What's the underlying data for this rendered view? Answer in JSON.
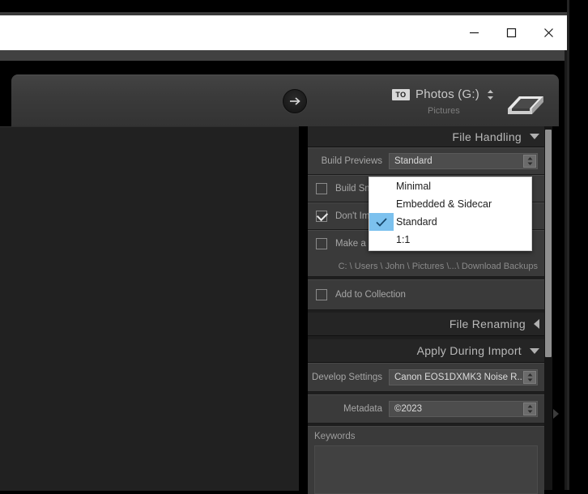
{
  "window": {
    "controls": [
      {
        "name": "minimize",
        "glyph": "minimize-icon"
      },
      {
        "name": "maximize",
        "glyph": "maximize-icon"
      },
      {
        "name": "close",
        "glyph": "close-icon"
      }
    ]
  },
  "topbar": {
    "go_icon": "arrow-right-circle-icon",
    "to_badge": "TO",
    "destination": "Photos (G:)",
    "destination_sub": "Pictures",
    "drive_icon": "hard-drive-icon",
    "spinner_icon": "updown-spinner-icon"
  },
  "panels": {
    "file_handling": {
      "title": "File Handling",
      "toggle_icon": "triangle-down-icon",
      "build_previews": {
        "label": "Build Previews",
        "value": "Standard",
        "spinner_icon": "updown-spinner-icon"
      },
      "checkboxes": [
        {
          "label": "Build Smart Previews",
          "checked": false,
          "truncated": "Build Sm"
        },
        {
          "label": "Don't Import Suspected Duplicates",
          "checked": true,
          "truncated": "Don't Im"
        },
        {
          "label": "Make a Second Copy To:",
          "checked": false,
          "truncated": "Make a S"
        }
      ],
      "second_copy_path": "C: \\ Users \\ John \\ Pictures \\...\\ Download Backups",
      "add_to_collection": {
        "label": "Add to Collection",
        "checked": false
      }
    },
    "file_renaming": {
      "title": "File Renaming",
      "toggle_icon": "triangle-left-icon"
    },
    "apply_during_import": {
      "title": "Apply During Import",
      "toggle_icon": "triangle-down-icon",
      "develop_settings": {
        "label": "Develop Settings",
        "value": "Canon EOS1DXMK3 Noise R...",
        "spinner_icon": "updown-spinner-icon"
      },
      "metadata": {
        "label": "Metadata",
        "value": "©2023",
        "spinner_icon": "updown-spinner-icon"
      },
      "keywords": {
        "label": "Keywords",
        "value": ""
      }
    }
  },
  "dropdown": {
    "open": true,
    "selected": "Standard",
    "check_icon": "check-icon",
    "highlight_color": "#7cc1ee",
    "items": [
      {
        "label": "Minimal",
        "selected": false
      },
      {
        "label": "Embedded & Sidecar",
        "selected": false
      },
      {
        "label": "Standard",
        "selected": true
      },
      {
        "label": "1:1",
        "selected": false
      }
    ]
  },
  "scrollbar": {
    "name": "panel-scrollbar",
    "thumb_name": "panel-scrollbar-thumb"
  },
  "collapse_arrow_icon": "triangle-right-icon"
}
